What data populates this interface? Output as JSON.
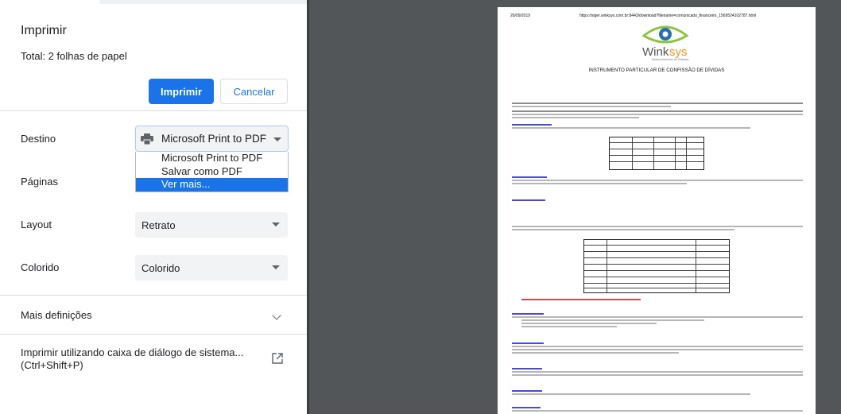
{
  "dialog": {
    "title": "Imprimir",
    "total": "Total: 2 folhas de papel",
    "print_button": "Imprimir",
    "cancel_button": "Cancelar"
  },
  "settings": {
    "destination": {
      "label": "Destino",
      "value": "Microsoft Print to PDF",
      "options": [
        "Microsoft Print to PDF",
        "Salvar como PDF",
        "Ver mais..."
      ],
      "highlighted": "Ver mais..."
    },
    "pages": {
      "label": "Páginas"
    },
    "layout": {
      "label": "Layout",
      "value": "Retrato"
    },
    "color": {
      "label": "Colorido",
      "value": "Colorido"
    },
    "more_settings": {
      "label": "Mais definições"
    },
    "system_dialog": {
      "line1": "Imprimir utilizando caixa de diálogo de sistema...",
      "line2": "(Ctrl+Shift+P)"
    }
  },
  "preview": {
    "header_date": "26/09/2019",
    "header_url": "https://siger.winksys.com.br:8443/download?filename=comunicado_financeiro_1569524102787.html",
    "logo_text": "Winksys",
    "logo_sub": "Desenvolvimento de Software",
    "doc_title": "INSTRUMENTO PARTICULAR DE CONFISSÃO DE DÍVIDAS",
    "signature_note": "O presente instrumento deve ser assinado com firma reconhecida."
  },
  "colors": {
    "accent": "#1a73e8",
    "preview_bg": "#525659",
    "logo_green": "#8bc53f",
    "logo_orange": "#f7941d"
  }
}
